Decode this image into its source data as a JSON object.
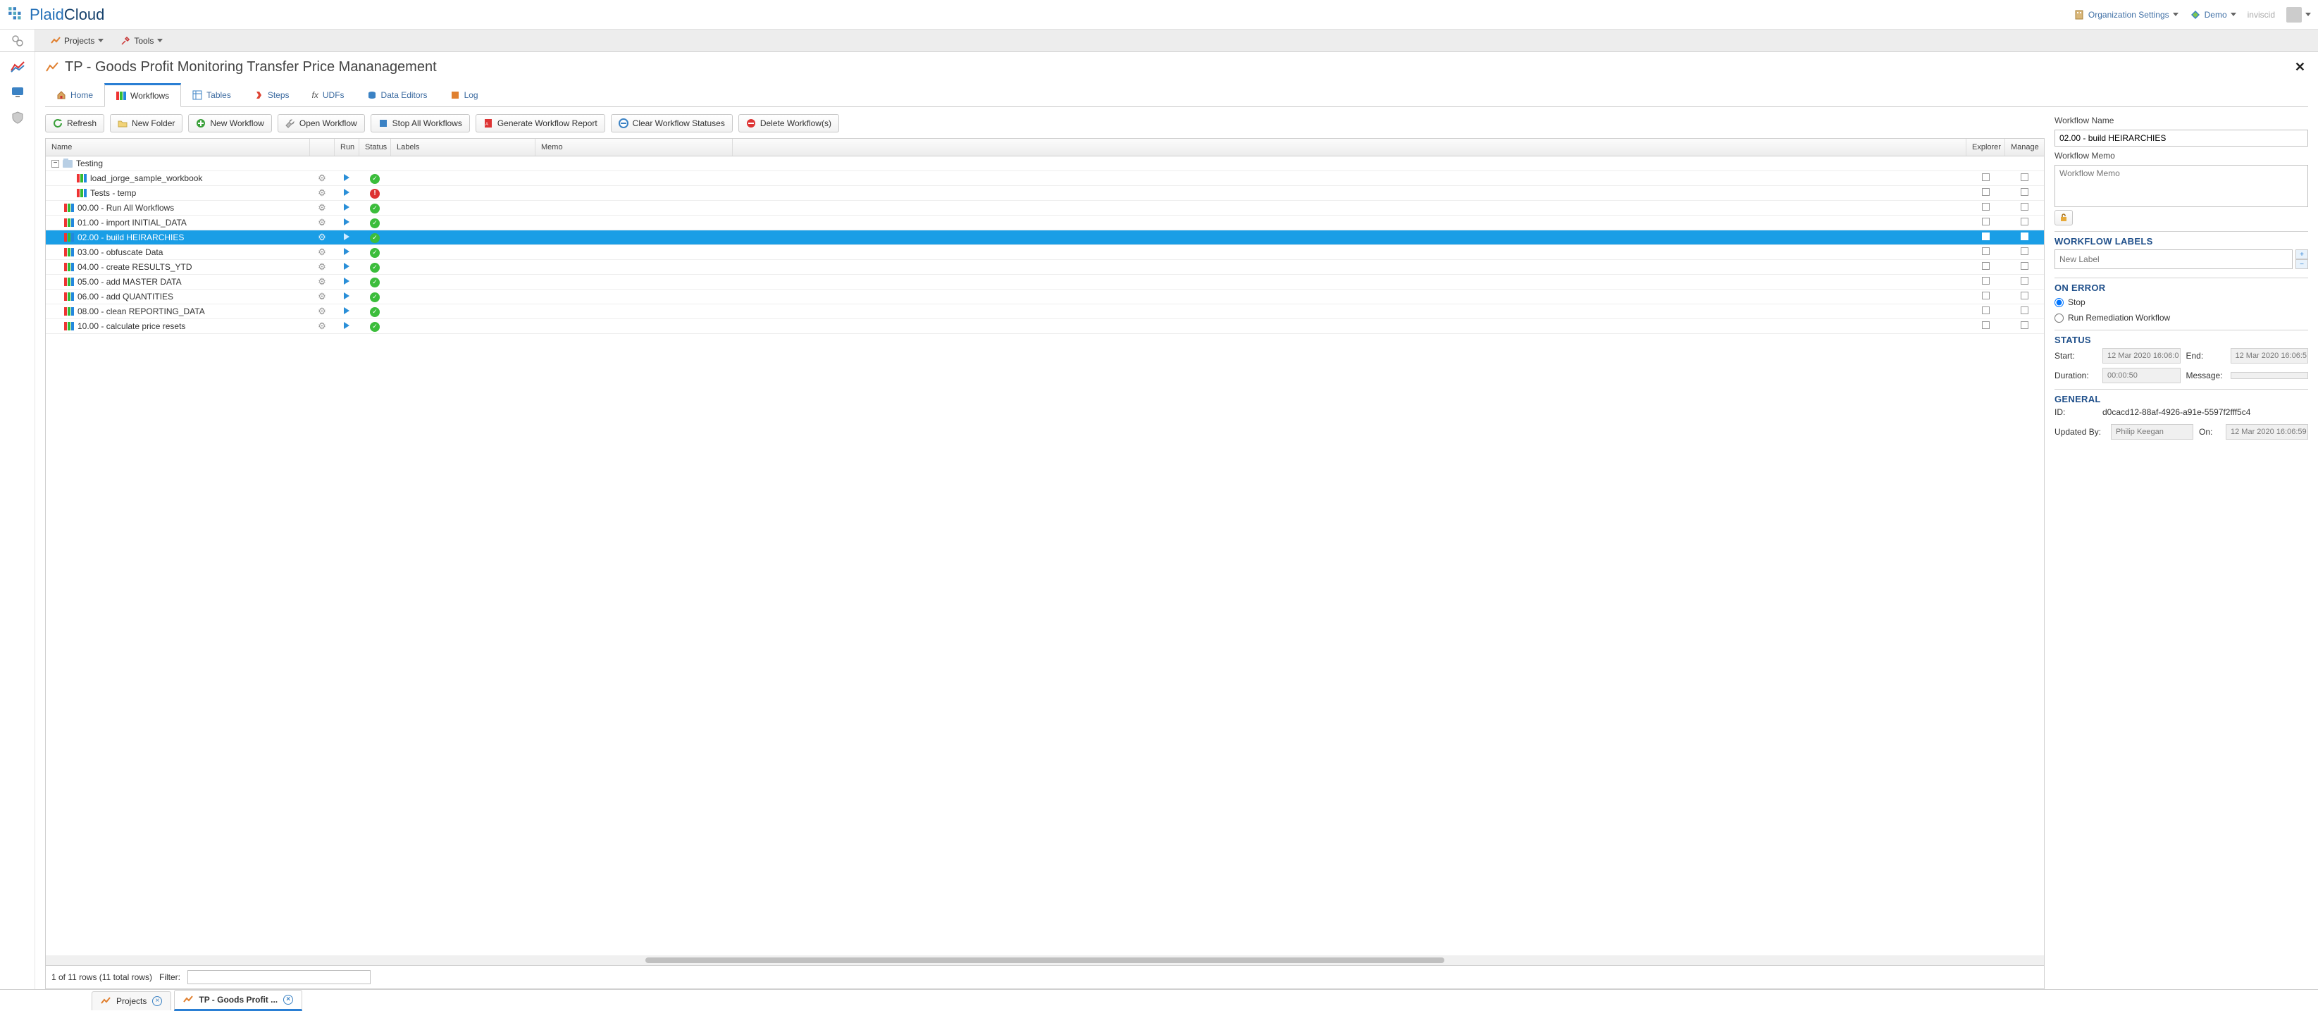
{
  "topbar": {
    "brand_part1": "Plaid",
    "brand_part2": "Cloud",
    "org_settings": "Organization Settings",
    "workspace": "Demo",
    "user": "inviscid"
  },
  "menus": {
    "projects": "Projects",
    "tools": "Tools"
  },
  "page_title": "TP - Goods Profit Monitoring Transfer Price Mananagement",
  "tabs": {
    "home": "Home",
    "workflows": "Workflows",
    "tables": "Tables",
    "steps": "Steps",
    "udfs": "UDFs",
    "data_editors": "Data Editors",
    "log": "Log"
  },
  "toolbar": {
    "refresh": "Refresh",
    "new_folder": "New Folder",
    "new_workflow": "New Workflow",
    "open_workflow": "Open Workflow",
    "stop_all": "Stop All Workflows",
    "generate_report": "Generate Workflow Report",
    "clear_statuses": "Clear Workflow Statuses",
    "delete_workflows": "Delete Workflow(s)"
  },
  "grid_headers": {
    "name": "Name",
    "run": "Run",
    "status": "Status",
    "labels": "Labels",
    "memo": "Memo",
    "explorer": "Explorer",
    "manage": "Manage"
  },
  "folder": "Testing",
  "rows": [
    {
      "name": "load_jorge_sample_workbook",
      "status": "ok",
      "indent": 2,
      "selected": false
    },
    {
      "name": "Tests - temp",
      "status": "err",
      "indent": 2,
      "selected": false
    },
    {
      "name": "00.00 - Run All Workflows",
      "status": "ok",
      "indent": 1,
      "selected": false
    },
    {
      "name": "01.00 - import INITIAL_DATA",
      "status": "ok",
      "indent": 1,
      "selected": false
    },
    {
      "name": "02.00 - build HEIRARCHIES",
      "status": "ok",
      "indent": 1,
      "selected": true
    },
    {
      "name": "03.00 - obfuscate Data",
      "status": "ok",
      "indent": 1,
      "selected": false
    },
    {
      "name": "04.00 - create RESULTS_YTD",
      "status": "ok",
      "indent": 1,
      "selected": false
    },
    {
      "name": "05.00 - add MASTER DATA",
      "status": "ok",
      "indent": 1,
      "selected": false
    },
    {
      "name": "06.00 - add QUANTITIES",
      "status": "ok",
      "indent": 1,
      "selected": false
    },
    {
      "name": "08.00 - clean REPORTING_DATA",
      "status": "ok",
      "indent": 1,
      "selected": false
    },
    {
      "name": "10.00 - calculate price resets",
      "status": "ok",
      "indent": 1,
      "selected": false
    }
  ],
  "grid_footer": {
    "count": "1 of 11 rows (11 total rows)",
    "filter_label": "Filter:"
  },
  "details": {
    "wf_name_label": "Workflow Name",
    "wf_name_value": "02.00 - build HEIRARCHIES",
    "wf_memo_label": "Workflow Memo",
    "wf_memo_placeholder": "Workflow Memo",
    "labels_header": "WORKFLOW LABELS",
    "new_label_placeholder": "New Label",
    "on_error_header": "ON ERROR",
    "stop": "Stop",
    "remediation": "Run Remediation Workflow",
    "status_header": "STATUS",
    "start_label": "Start:",
    "start_value": "12 Mar 2020 16:06:0",
    "end_label": "End:",
    "end_value": "12 Mar 2020 16:06:5",
    "duration_label": "Duration:",
    "duration_value": "00:00:50",
    "message_label": "Message:",
    "message_value": "",
    "general_header": "GENERAL",
    "id_label": "ID:",
    "id_value": "d0cacd12-88af-4926-a91e-5597f2fff5c4",
    "updated_by_label": "Updated By:",
    "updated_by_value": "Philip Keegan",
    "on_label": "On:",
    "on_value": "12 Mar 2020 16:06:59"
  },
  "bottom_tabs": {
    "projects": "Projects",
    "goods": "TP - Goods Profit ..."
  }
}
